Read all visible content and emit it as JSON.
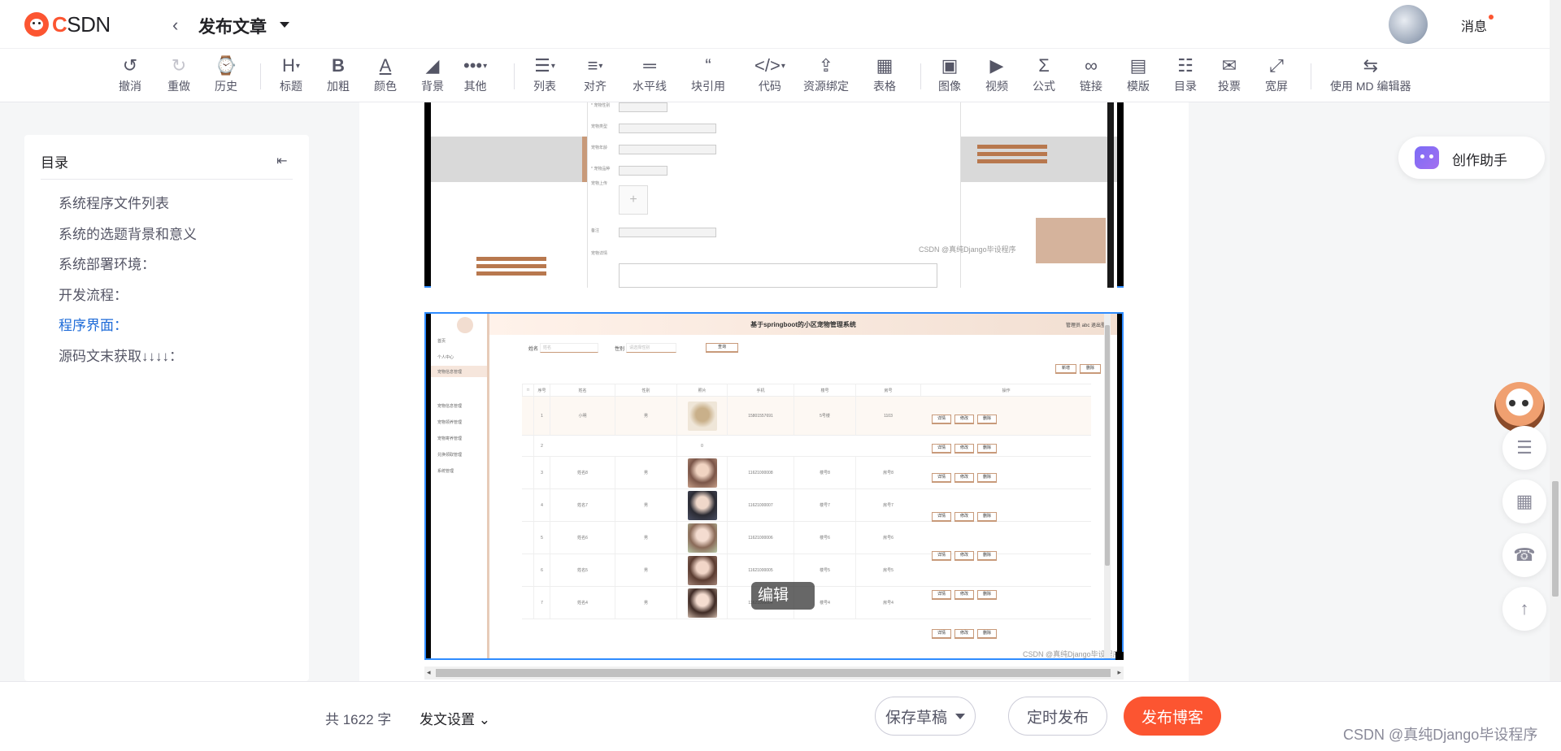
{
  "header": {
    "logo": "CSDN",
    "page_title": "发布文章",
    "messages_label": "消息"
  },
  "toolbar": {
    "undo": "撤消",
    "redo": "重做",
    "history": "历史",
    "heading": "标题",
    "bold": "加粗",
    "color": "颜色",
    "background": "背景",
    "other": "其他",
    "list": "列表",
    "align": "对齐",
    "hr": "水平线",
    "quote": "块引用",
    "code": "代码",
    "resource": "资源绑定",
    "table": "表格",
    "image": "图像",
    "video": "视频",
    "formula": "公式",
    "link": "链接",
    "template": "模版",
    "toc": "目录",
    "vote": "投票",
    "wide": "宽屏",
    "md_editor": "使用 MD 编辑器"
  },
  "toc": {
    "title": "目录",
    "items": [
      {
        "label": "系统程序文件列表",
        "active": false
      },
      {
        "label": "系统的选题背景和意义",
        "active": false
      },
      {
        "label": "系统部署环境：",
        "active": false
      },
      {
        "label": "开发流程：",
        "active": false
      },
      {
        "label": "程序界面：",
        "active": true
      },
      {
        "label": "源码文末获取↓↓↓↓：",
        "active": false
      }
    ]
  },
  "editor": {
    "watermark_1": "CSDN @真纯Django毕设程序",
    "watermark_2": "CSDN @真纯Django毕设程序",
    "image_tooltip": "编辑",
    "admin_title": "基于springboot的小区宠物管理系统",
    "admin_user": "管理员 abc  退出登录"
  },
  "assistant": {
    "label": "创作助手"
  },
  "bottom": {
    "word_count": "共 1622 字",
    "post_settings": "发文设置",
    "save_draft": "保存草稿",
    "schedule": "定时发布",
    "publish": "发布博客"
  },
  "footer_watermark": "CSDN @真纯Django毕设程序",
  "colors": {
    "brand": "#fc5531",
    "toc_active": "#1e6bd8",
    "image_border": "#2f8cff"
  }
}
